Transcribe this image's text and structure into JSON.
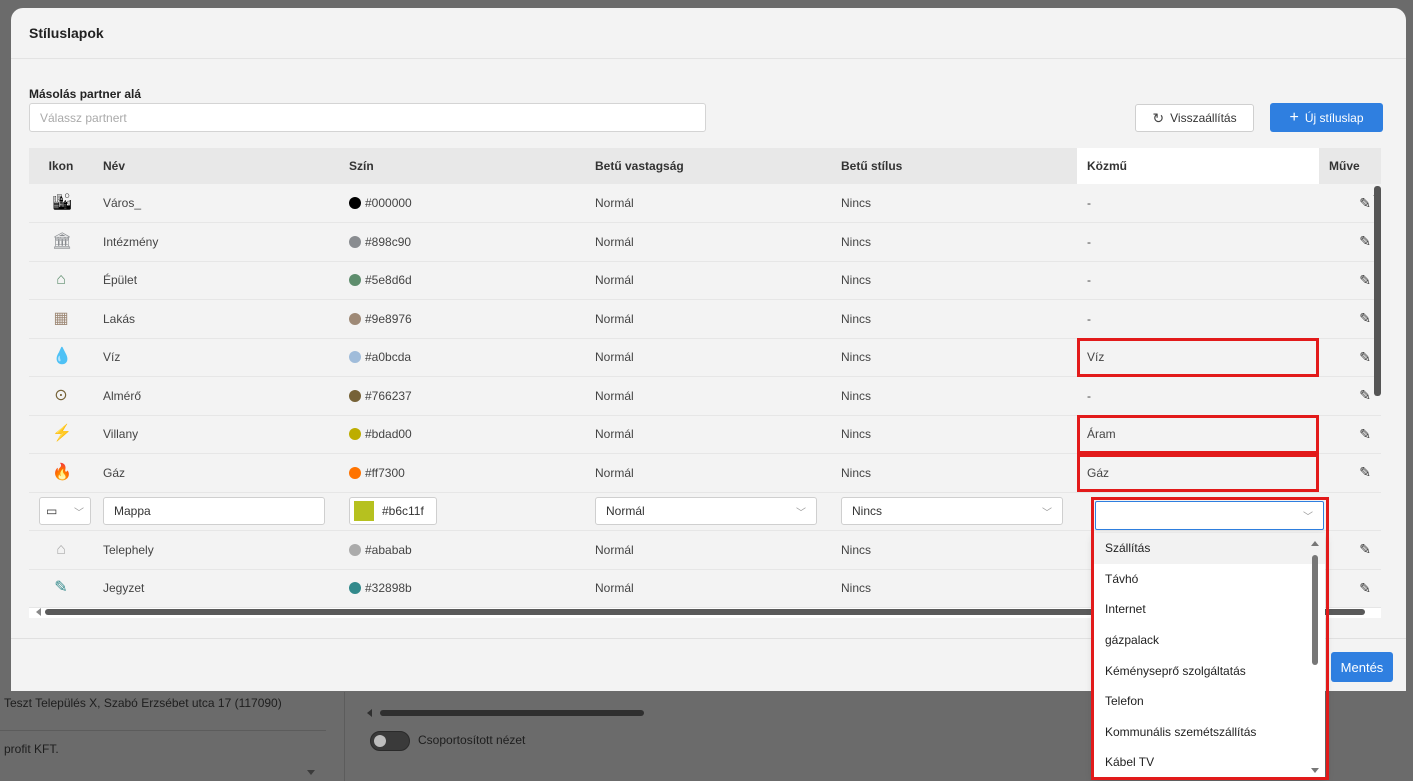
{
  "background": {
    "address": "Teszt Település X, Szabó Erzsébet utca 17 (117090)",
    "company": "profit KFT.",
    "toggle_label": "Csoportosított nézet"
  },
  "modal": {
    "title": "Stíluslapok",
    "copy_label": "Másolás partner alá",
    "partner_placeholder": "Válassz partnert",
    "reset_label": "Visszaállítás",
    "new_label": "Új stíluslap",
    "save_label": "Mentés"
  },
  "table": {
    "headers": {
      "icon": "Ikon",
      "name": "Név",
      "color": "Szín",
      "weight": "Betű vastagság",
      "style": "Betű stílus",
      "utility": "Közmű",
      "actions": "Műve"
    },
    "rows": [
      {
        "icon": "city-icon",
        "glyph": "🏙",
        "name": "Város_",
        "color": "#000000",
        "weight": "Normál",
        "style": "Nincs",
        "utility": "-"
      },
      {
        "icon": "institution-icon",
        "glyph": "🏛",
        "name": "Intézmény",
        "color": "#898c90",
        "weight": "Normál",
        "style": "Nincs",
        "utility": "-"
      },
      {
        "icon": "building-icon",
        "glyph": "⌂",
        "name": "Épület",
        "color": "#5e8d6d",
        "weight": "Normál",
        "style": "Nincs",
        "utility": "-"
      },
      {
        "icon": "apartment-icon",
        "glyph": "▦",
        "name": "Lakás",
        "color": "#9e8976",
        "weight": "Normál",
        "style": "Nincs",
        "utility": "-"
      },
      {
        "icon": "water-drop-icon",
        "glyph": "💧",
        "name": "Víz",
        "color": "#a0bcda",
        "weight": "Normál",
        "style": "Nincs",
        "utility": "Víz"
      },
      {
        "icon": "meter-icon",
        "glyph": "⊙",
        "name": "Almérő",
        "color": "#766237",
        "weight": "Normál",
        "style": "Nincs",
        "utility": "-"
      },
      {
        "icon": "lightning-icon",
        "glyph": "⚡",
        "name": "Villany",
        "color": "#bdad00",
        "weight": "Normál",
        "style": "Nincs",
        "utility": "Áram"
      },
      {
        "icon": "flame-icon",
        "glyph": "🔥",
        "name": "Gáz",
        "color": "#ff7300",
        "weight": "Normál",
        "style": "Nincs",
        "utility": "Gáz"
      }
    ],
    "edit_row": {
      "icon": "folder-icon",
      "name": "Mappa",
      "color": "#b6c11f",
      "weight": "Normál",
      "style": "Nincs"
    },
    "rows_after": [
      {
        "icon": "site-icon",
        "glyph": "⌂",
        "name": "Telephely",
        "color": "#ababab",
        "weight": "Normál",
        "style": "Nincs"
      },
      {
        "icon": "note-icon",
        "glyph": "✎",
        "name": "Jegyzet",
        "color": "#32898b",
        "weight": "Normál",
        "style": "Nincs"
      }
    ]
  },
  "dropdown": {
    "options": [
      "Szállítás",
      "Távhó",
      "Internet",
      "gázpalack",
      "Kéményseprő szolgáltatás",
      "Telefon",
      "Kommunális szemétszállítás",
      "Kábel TV"
    ],
    "active_index": 0
  }
}
